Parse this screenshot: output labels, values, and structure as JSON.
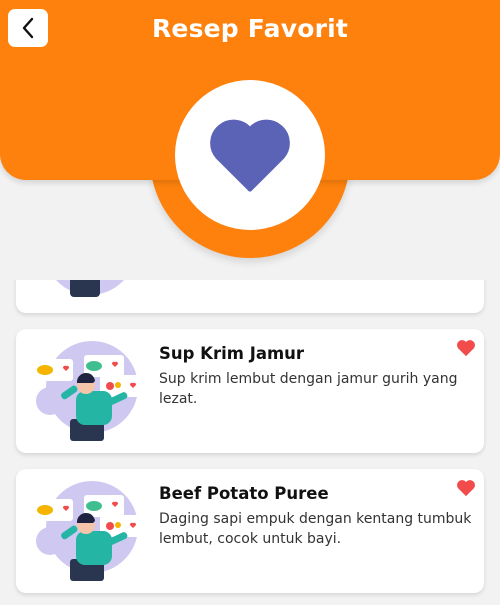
{
  "header": {
    "title": "Resep Favorit",
    "back_icon": "chevron-left-icon",
    "badge_icon": "heart-icon",
    "background_color": "#fd810c",
    "badge_heart_color": "#5b63b7"
  },
  "recipes": [
    {
      "title": "",
      "description": "",
      "favorite": true
    },
    {
      "title": "Sup Krim Jamur",
      "description": "Sup krim lembut dengan jamur gurih yang lezat.",
      "favorite": true
    },
    {
      "title": "Beef Potato Puree",
      "description": "Daging sapi empuk dengan kentang tumbuk lembut, cocok untuk bayi.",
      "favorite": true
    }
  ],
  "colors": {
    "favorite_heart": "#f24b4b",
    "card_bg": "#ffffff"
  }
}
